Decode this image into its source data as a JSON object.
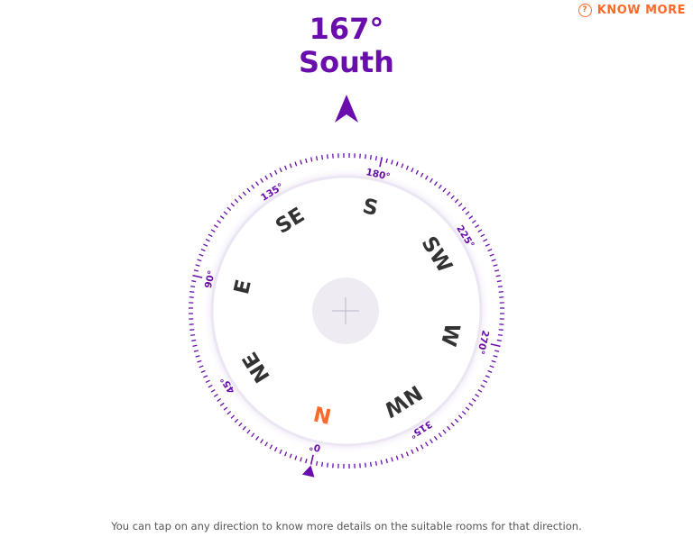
{
  "header": {
    "know_more_icon": "question-circle-icon",
    "know_more_label": "KNOW MORE",
    "degree_text": "167°",
    "direction_text": "South"
  },
  "compass": {
    "heading_degrees": 167,
    "pointer_icon": "navigation-arrow-icon",
    "center_icon": "plus-icon",
    "zero_marker_icon": "triangle-marker-icon",
    "degree_labels": [
      {
        "deg": 0,
        "text": "0°"
      },
      {
        "deg": 45,
        "text": "45°"
      },
      {
        "deg": 90,
        "text": "90°"
      },
      {
        "deg": 135,
        "text": "135°"
      },
      {
        "deg": 180,
        "text": "180°"
      },
      {
        "deg": 225,
        "text": "225°"
      },
      {
        "deg": 270,
        "text": "270°"
      },
      {
        "deg": 315,
        "text": "315°"
      }
    ],
    "directions": [
      {
        "deg": 0,
        "text": "N",
        "highlight": true
      },
      {
        "deg": 45,
        "text": "NE",
        "highlight": false
      },
      {
        "deg": 90,
        "text": "E",
        "highlight": false
      },
      {
        "deg": 135,
        "text": "SE",
        "highlight": false
      },
      {
        "deg": 180,
        "text": "S",
        "highlight": false
      },
      {
        "deg": 225,
        "text": "SW",
        "highlight": false
      },
      {
        "deg": 270,
        "text": "W",
        "highlight": false
      },
      {
        "deg": 315,
        "text": "NW",
        "highlight": false
      }
    ]
  },
  "colors": {
    "primary": "#6a0dad",
    "accent": "#ff6a2b",
    "direction_text": "#333333"
  },
  "footer": {
    "note": "You can tap on any direction to know more details on the suitable rooms for that direction."
  }
}
